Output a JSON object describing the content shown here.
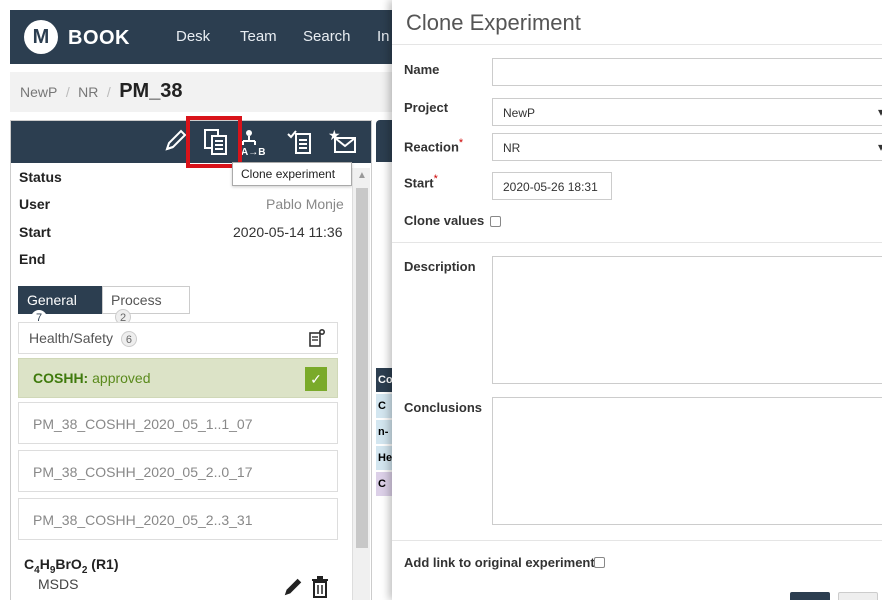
{
  "nav": {
    "logo_letter": "M",
    "brand": "BOOK",
    "links": [
      "Desk",
      "Team",
      "Search",
      "In"
    ]
  },
  "breadcrumb": {
    "items": [
      "NewP",
      "NR"
    ],
    "current": "PM_38"
  },
  "toolbar": {
    "icons": [
      "pencil-icon",
      "clone-icon",
      "reaction-scheme-icon",
      "checklist-icon",
      "star-mail-icon"
    ],
    "reaction_label": "A→B",
    "tooltip": "Clone experiment"
  },
  "details": {
    "status_label": "Status",
    "user_label": "User",
    "user_value": "Pablo Monje",
    "start_label": "Start",
    "start_value": "2020-05-14 11:36",
    "end_label": "End"
  },
  "tabs": [
    {
      "label": "General",
      "count": "7"
    },
    {
      "label": "Process",
      "count": "2"
    }
  ],
  "health_safety": {
    "label": "Health/Safety",
    "count": "6",
    "coshh_bold": "COSHH:",
    "coshh_status": "approved",
    "files": [
      "PM_38_COSHH_2020_05_1..1_07",
      "PM_38_COSHH_2020_05_2..0_17",
      "PM_38_COSHH_2020_05_2..3_31"
    ]
  },
  "reagent": {
    "formula_html_parts": [
      "C",
      "4",
      "H",
      "9",
      "BrO",
      "2",
      " (R1)"
    ],
    "msds": "MSDS"
  },
  "peek": {
    "cells": [
      "Co",
      "C",
      "n-",
      "He",
      "C"
    ]
  },
  "modal": {
    "title": "Clone Experiment",
    "name_label": "Name",
    "name_value": "",
    "project_label": "Project",
    "project_value": "NewP",
    "reaction_label": "Reaction",
    "reaction_value": "NR",
    "start_label": "Start",
    "start_value": "2020-05-26 18:31",
    "clone_values_label": "Clone values",
    "description_label": "Description",
    "conclusions_label": "Conclusions",
    "add_link_label": "Add link to original experiment",
    "required_mark": "*"
  },
  "colors": {
    "navbar": "#2c3e50",
    "coshh_bg": "#dce3c7",
    "coshh_text": "#5a8a1c",
    "highlight": "#d9131a",
    "peek_blue": "#d3e6f0",
    "peek_purple": "#dcd0e8"
  }
}
